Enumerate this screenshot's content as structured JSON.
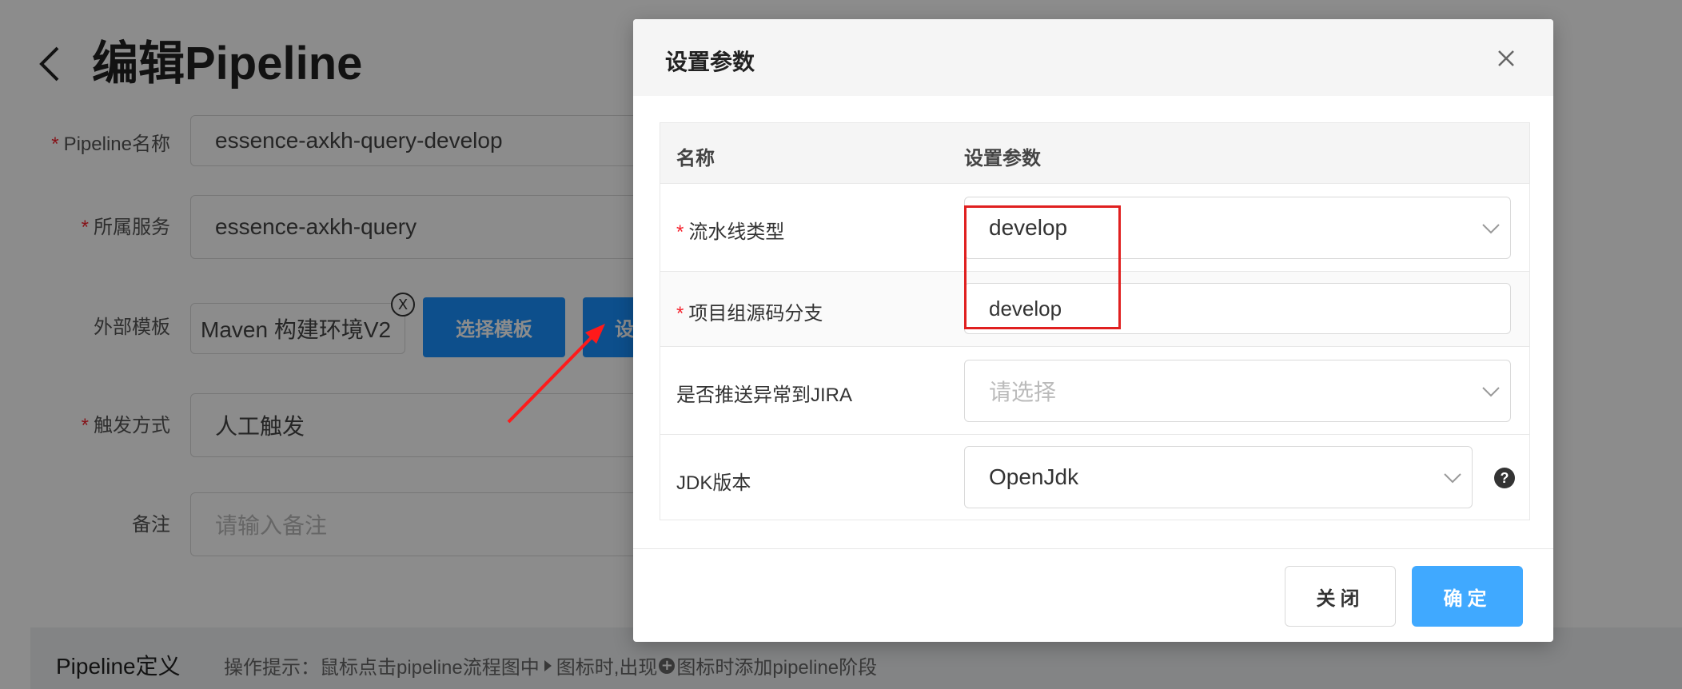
{
  "page": {
    "title": "编辑Pipeline",
    "form": {
      "pipeline_name_label": "Pipeline名称",
      "pipeline_name_value": "essence-axkh-query-develop",
      "service_label": "所属服务",
      "service_value": "essence-axkh-query",
      "template_label": "外部模板",
      "template_value": "Maven 构建环境V2",
      "template_clear": "X",
      "select_template_button": "选择模板",
      "set_params_button_partial": "设",
      "trigger_label": "触发方式",
      "trigger_value": "人工触发",
      "remark_label": "备注",
      "remark_placeholder": "请输入备注",
      "required_mark": "*"
    },
    "definition": {
      "title": "Pipeline定义",
      "hint_prefix": "操作提示：鼠标点击pipeline流程图中",
      "hint_middle": "图标时,出现",
      "hint_plus": "+",
      "hint_suffix": "图标时添加pipeline阶段"
    }
  },
  "modal": {
    "title": "设置参数",
    "table": {
      "headers": [
        "名称",
        "设置参数"
      ],
      "rows": [
        {
          "label": "流水线类型",
          "required": "*",
          "value": "develop"
        },
        {
          "label": "项目组源码分支",
          "required": "*",
          "value": "develop"
        },
        {
          "label": "是否推送异常到JIRA",
          "placeholder": "请选择"
        },
        {
          "label": "JDK版本",
          "value": "OpenJdk",
          "help": "?"
        }
      ]
    },
    "close_button": "关闭",
    "ok_button": "确定"
  },
  "colors": {
    "primary": "#1890ff",
    "ok_button": "#40a9ff",
    "required": "#f5222d",
    "annotation_red": "#e02020"
  }
}
